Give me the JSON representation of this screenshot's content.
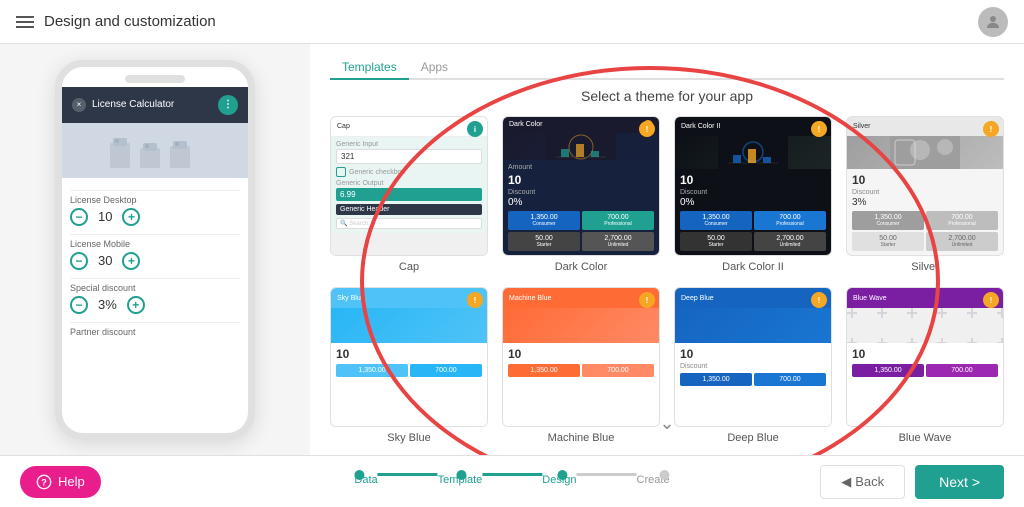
{
  "header": {
    "title": "Design and customization",
    "menu_icon": "menu-icon",
    "avatar_icon": "person-icon"
  },
  "phone": {
    "app_name": "License Calculator",
    "close_icon": "×",
    "dots_icon": "⋮",
    "license_desktop_label": "License Desktop",
    "license_desktop_value": "10",
    "license_mobile_label": "License Mobile",
    "license_mobile_value": "30",
    "special_discount_label": "Special discount",
    "special_discount_value": "3%",
    "partner_discount_label": "Partner discount"
  },
  "theme_panel": {
    "title": "Select a theme for your app",
    "tabs": [
      {
        "label": "Templates",
        "active": true
      },
      {
        "label": "Apps",
        "active": false
      }
    ],
    "themes": [
      {
        "name": "Cap",
        "badge": "i",
        "badge_type": "green"
      },
      {
        "name": "Dark Color",
        "badge": "!",
        "badge_type": "orange"
      },
      {
        "name": "Dark Color II",
        "badge": "!",
        "badge_type": "orange"
      },
      {
        "name": "Silver",
        "badge": "!",
        "badge_type": "orange"
      },
      {
        "name": "Sky Blue",
        "badge": "!",
        "badge_type": "orange"
      },
      {
        "name": "Machine Blue",
        "badge": "!",
        "badge_type": "orange"
      },
      {
        "name": "Deep Blue",
        "badge": "!",
        "badge_type": "orange"
      },
      {
        "name": "Blue Wave",
        "badge": "!",
        "badge_type": "orange"
      }
    ]
  },
  "footer": {
    "help_label": "Help",
    "steps": [
      {
        "label": "Data",
        "active": true
      },
      {
        "label": "Template",
        "active": true
      },
      {
        "label": "Design",
        "active": true
      },
      {
        "label": "Create",
        "active": false
      }
    ],
    "back_label": "◀  Back",
    "next_label": "Next  ▶"
  }
}
